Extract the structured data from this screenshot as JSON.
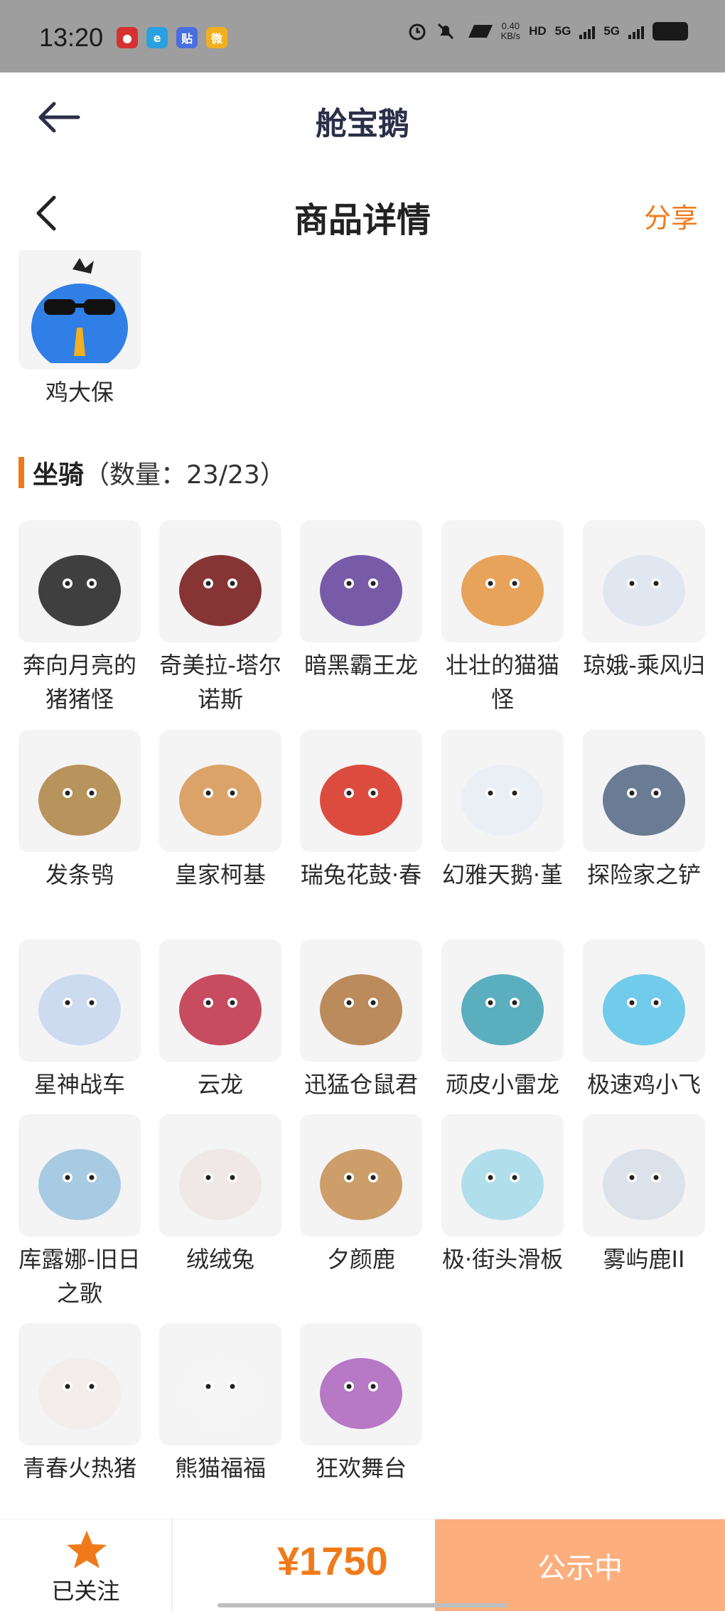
{
  "status_bar": {
    "time": "13:20",
    "speed": "0.40",
    "speed_unit": "KB/s",
    "hd": "HD",
    "net1": "5G",
    "net2": "5G",
    "app_icons": [
      "netease-music-icon",
      "e-app-icon",
      "tieba-icon",
      "weibo-icon"
    ]
  },
  "app_bar": {
    "title": "舱宝鹅"
  },
  "header": {
    "title": "商品详情",
    "share": "分享"
  },
  "pet_item": {
    "label": "鸡大保",
    "image": "blue-bird-sunglasses"
  },
  "section": {
    "title": "坐骑",
    "count": "（数量：23/23）"
  },
  "mounts": [
    {
      "label": "奔向月亮的猪猪怪"
    },
    {
      "label": "奇美拉-塔尔诺斯"
    },
    {
      "label": "暗黑霸王龙"
    },
    {
      "label": "壮壮的猫猫怪"
    },
    {
      "label": "琼娥-乘风归"
    },
    {
      "label": "发条鸮"
    },
    {
      "label": "皇家柯基"
    },
    {
      "label": "瑞兔花鼓·春"
    },
    {
      "label": "幻雅天鹅·堇"
    },
    {
      "label": "探险家之铲"
    },
    {
      "label": "星神战车"
    },
    {
      "label": "云龙"
    },
    {
      "label": "迅猛仓鼠君"
    },
    {
      "label": "顽皮小雷龙"
    },
    {
      "label": "极速鸡小飞"
    },
    {
      "label": "库露娜-旧日之歌"
    },
    {
      "label": "绒绒兔"
    },
    {
      "label": "夕颜鹿"
    },
    {
      "label": "极·街头滑板"
    },
    {
      "label": "雾屿鹿II"
    },
    {
      "label": "青春火热猪"
    },
    {
      "label": "熊猫福福"
    },
    {
      "label": "狂欢舞台"
    }
  ],
  "bottom_bar": {
    "follow_label": "已关注",
    "price": "¥1750",
    "status_button": "公示中"
  },
  "colors": {
    "accent": "#f07a1a",
    "button_bg": "#fcae7d",
    "status_bar_bg": "#9e9e9e",
    "thumb_bg": "#f4f4f5"
  }
}
